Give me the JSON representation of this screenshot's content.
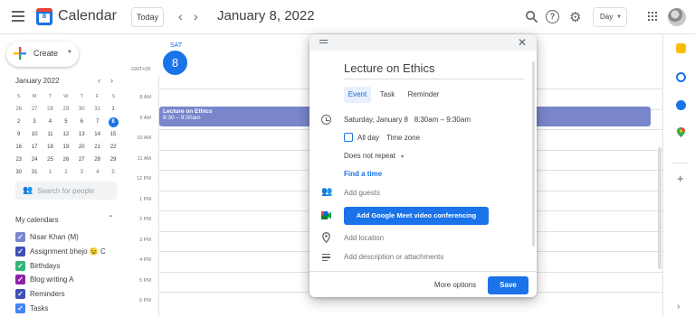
{
  "header": {
    "app_logo_day": "8",
    "app_title": "Calendar",
    "today_label": "Today",
    "prev_icon": "‹",
    "next_icon": "›",
    "date_title": "January 8, 2022",
    "help_icon": "?",
    "gear_icon": "⚙",
    "view_label": "Day",
    "view_caret": "▼"
  },
  "sidebar": {
    "create_label": "Create",
    "create_caret": "▼",
    "mini_calendar": {
      "title": "January 2022",
      "prev": "‹",
      "next": "›",
      "weekdays": [
        "S",
        "M",
        "T",
        "W",
        "T",
        "F",
        "S"
      ],
      "weeks": [
        [
          "26",
          "27",
          "28",
          "29",
          "30",
          "31",
          "1"
        ],
        [
          "2",
          "3",
          "4",
          "5",
          "6",
          "7",
          "8"
        ],
        [
          "9",
          "10",
          "11",
          "12",
          "13",
          "14",
          "15"
        ],
        [
          "16",
          "17",
          "18",
          "19",
          "20",
          "21",
          "22"
        ],
        [
          "23",
          "24",
          "25",
          "26",
          "27",
          "28",
          "29"
        ],
        [
          "30",
          "31",
          "1",
          "2",
          "3",
          "4",
          "5"
        ]
      ],
      "selected_day": "8"
    },
    "people_search_placeholder": "Search for people",
    "people_icon": "👥",
    "my_calendars_title": "My calendars",
    "my_calendars_caret": "⌃",
    "calendars": [
      {
        "name": "Nisar Khan (M)",
        "color": "#7986cb"
      },
      {
        "name": "Assignment bhejo 😉 C",
        "color": "#3f51b5"
      },
      {
        "name": "Birthdays",
        "color": "#33b679"
      },
      {
        "name": "Blog writing A",
        "color": "#8e24aa"
      },
      {
        "name": "Reminders",
        "color": "#3f51b5"
      },
      {
        "name": "Tasks",
        "color": "#4285f4"
      }
    ],
    "check_mark": "✓"
  },
  "day_view": {
    "day_name": "SAT",
    "day_number": "8",
    "timezone": "GMT+05",
    "hours": [
      "8 AM",
      "9 AM",
      "10 AM",
      "11 AM",
      "12 PM",
      "1 PM",
      "2 PM",
      "3 PM",
      "4 PM",
      "5 PM",
      "6 PM"
    ],
    "event": {
      "title": "Lecture on Ethics",
      "time": "8:30 – 9:30am",
      "color": "#7986cb"
    }
  },
  "dialog": {
    "close_icon": "✕",
    "title": "Lecture on Ethics",
    "tabs": [
      "Event",
      "Task",
      "Reminder"
    ],
    "date": "Saturday, January 8",
    "start_time": "8:30am",
    "dash": "–",
    "end_time": "9:30am",
    "all_day_label": "All day",
    "time_zone_label": "Time zone",
    "repeat_label": "Does not repeat",
    "repeat_caret": "▼",
    "find_time_label": "Find a time",
    "guests_icon": "👥",
    "add_guests_placeholder": "Add guests",
    "meet_button_label": "Add Google Meet video conferencing",
    "add_location_placeholder": "Add location",
    "add_description_placeholder": "Add description or attachments",
    "more_options_label": "More options",
    "save_label": "Save"
  },
  "side_panel": {
    "add_icon": "+",
    "next_icon": "›"
  },
  "colors": {
    "accent": "#1a73e8",
    "event": "#7986cb"
  }
}
